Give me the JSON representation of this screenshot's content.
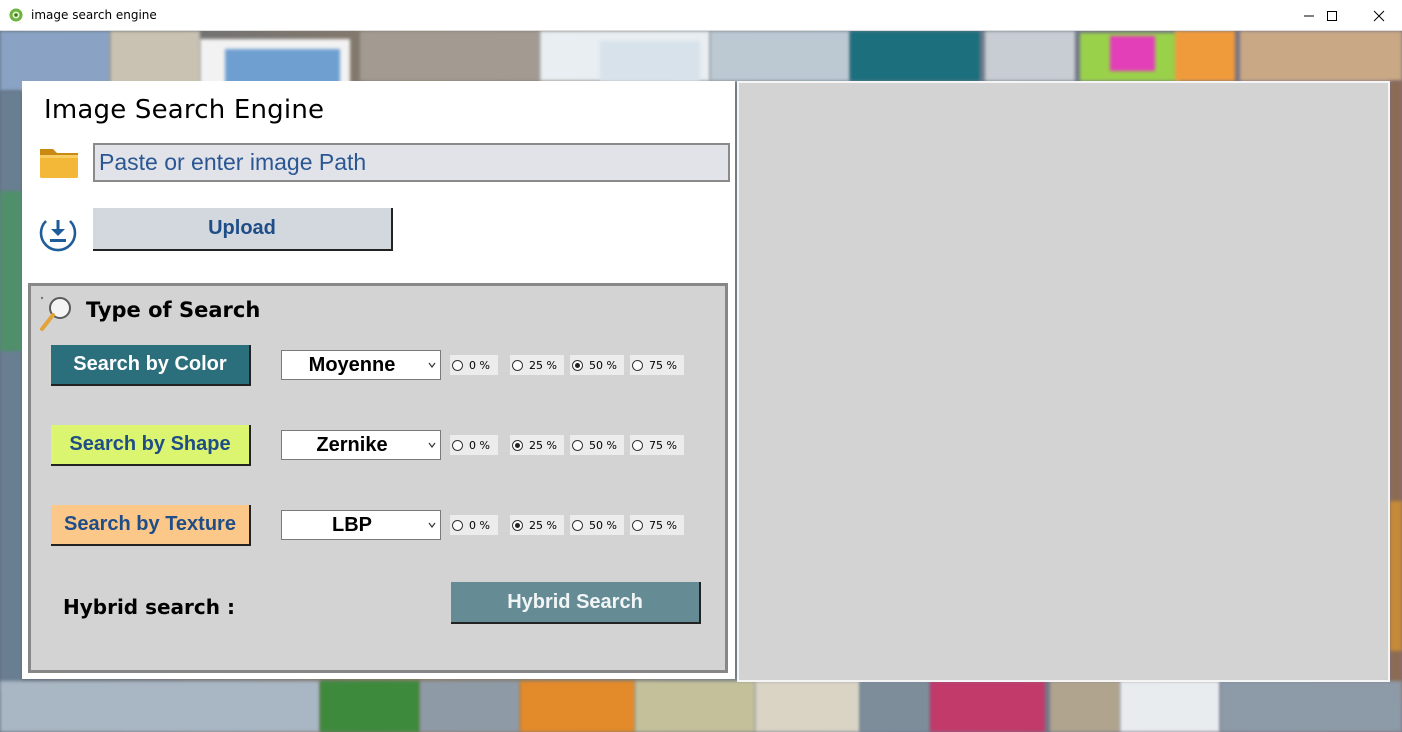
{
  "window": {
    "title": "image search engine",
    "app_icon": "app-logo-icon",
    "controls": [
      "minimize-icon",
      "maximize-icon",
      "close-icon"
    ]
  },
  "app": {
    "heading": "Image Search Engine"
  },
  "path_input": {
    "placeholder": "Paste or enter image Path",
    "value": ""
  },
  "upload": {
    "label": "Upload",
    "icon": "upload-icon"
  },
  "search_panel": {
    "title": "Type of Search",
    "icon": "magnifier-icon",
    "rows": [
      {
        "button": "Search by Color",
        "method": "Moyenne",
        "weights": [
          "0 %",
          "25 %",
          "50 %",
          "75 %"
        ],
        "selected_weight": "50 %"
      },
      {
        "button": "Search by Shape",
        "method": "Zernike",
        "weights": [
          "0 %",
          "25 %",
          "50 %",
          "75 %"
        ],
        "selected_weight": "25 %"
      },
      {
        "button": "Search by Texture",
        "method": "LBP",
        "weights": [
          "0 %",
          "25 %",
          "50 %",
          "75 %"
        ],
        "selected_weight": "25 %"
      }
    ],
    "hybrid_label": "Hybrid search :",
    "hybrid_button": "Hybrid Search"
  },
  "colors": {
    "color_button": "#2b6e7c",
    "shape_button": "#dcf570",
    "texture_button": "#fbc889",
    "hybrid_button": "#658c95",
    "panel_gray": "#d3d3d3",
    "accent_text": "#1f4d87"
  }
}
